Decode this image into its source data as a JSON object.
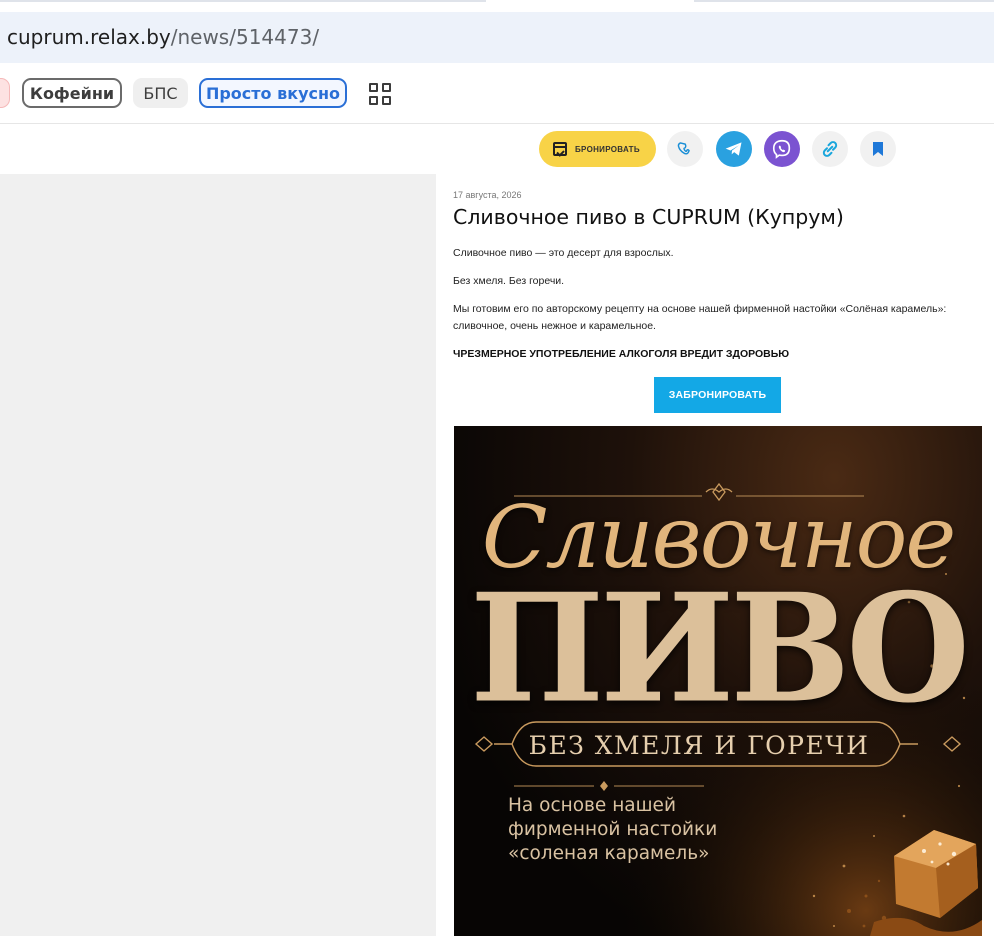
{
  "browser": {
    "url_host": "cuprum.relax.by",
    "url_path": "/news/514473/"
  },
  "tags": {
    "items": [
      {
        "label": "Кофейни"
      },
      {
        "label": "БПС"
      },
      {
        "label": "Просто вкусно"
      }
    ]
  },
  "actions": {
    "book_label": "БРОНИРОВАТЬ",
    "icons": [
      "calendar-check-icon",
      "phone-icon",
      "telegram-icon",
      "viber-icon",
      "share-link-icon",
      "bookmark-icon"
    ],
    "colors": {
      "book": "#f8d347",
      "telegram": "#2aa1e0",
      "viber": "#7b53d1",
      "cta": "#13a8e6"
    }
  },
  "article": {
    "date": "17 августа, 2026",
    "title": "Сливочное пиво в CUPRUM (Купрум)",
    "paragraphs": [
      "Сливочное пиво — это десерт для взрослых.",
      "Без хмеля. Без горечи.",
      "Мы готовим его по авторскому рецепту на основе нашей фирменной настойки «Солёная карамель»: сливочное, очень нежное и карамельное."
    ],
    "warning": "ЧРЕЗМЕРНОЕ УПОТРЕБЛЕНИЕ АЛКОГОЛЯ ВРЕДИТ ЗДОРОВЬЮ",
    "cta_label": "ЗАБРОНИРОВАТЬ"
  },
  "poster": {
    "script_title": "Сливочное",
    "big_title": "ПИВО",
    "band_text": "БЕЗ ХМЕЛЯ И ГОРЕЧИ",
    "sub_lines": [
      "На основе нашей",
      "фирменной настойки",
      "«соленая карамель»"
    ]
  }
}
